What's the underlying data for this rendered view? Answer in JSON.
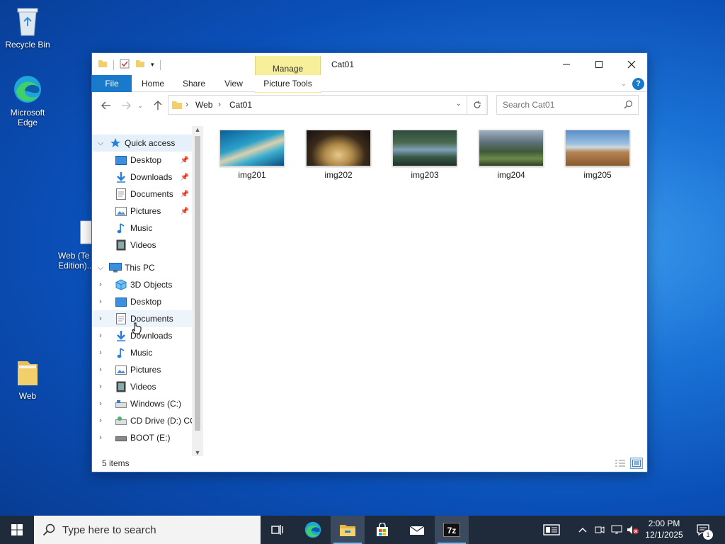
{
  "desktop": {
    "icons": [
      {
        "label": "Recycle Bin"
      },
      {
        "label": "Microsoft Edge"
      },
      {
        "label": "Web (Te Edition)..."
      },
      {
        "label": "Web"
      }
    ]
  },
  "window": {
    "title": "Cat01",
    "manage_tab": "Manage",
    "picture_tools_tab": "Picture Tools",
    "ribbon_tabs": [
      "File",
      "Home",
      "Share",
      "View"
    ],
    "help": "?",
    "address": {
      "crumbs": [
        "Web",
        "Cat01"
      ]
    },
    "search_placeholder": "Search Cat01"
  },
  "navpane": {
    "quick_access": "Quick access",
    "quick_items": [
      {
        "label": "Desktop",
        "icon": "desktop-icon"
      },
      {
        "label": "Downloads",
        "icon": "downloads-icon"
      },
      {
        "label": "Documents",
        "icon": "documents-icon"
      },
      {
        "label": "Pictures",
        "icon": "pictures-icon"
      },
      {
        "label": "Music",
        "icon": "music-icon"
      },
      {
        "label": "Videos",
        "icon": "videos-icon"
      }
    ],
    "this_pc": "This PC",
    "pc_items": [
      {
        "label": "3D Objects",
        "icon": "3d-objects-icon"
      },
      {
        "label": "Desktop",
        "icon": "desktop-icon"
      },
      {
        "label": "Documents",
        "icon": "documents-icon"
      },
      {
        "label": "Downloads",
        "icon": "downloads-icon"
      },
      {
        "label": "Music",
        "icon": "music-icon"
      },
      {
        "label": "Pictures",
        "icon": "pictures-icon"
      },
      {
        "label": "Videos",
        "icon": "videos-icon"
      },
      {
        "label": "Windows (C:)",
        "icon": "drive-icon"
      },
      {
        "label": "CD Drive (D:) CC",
        "icon": "cd-drive-icon"
      },
      {
        "label": "BOOT (E:)",
        "icon": "usb-drive-icon"
      }
    ]
  },
  "files": [
    {
      "name": "img201"
    },
    {
      "name": "img202"
    },
    {
      "name": "img203"
    },
    {
      "name": "img204"
    },
    {
      "name": "img205"
    }
  ],
  "status": {
    "count": "5 items"
  },
  "taskbar": {
    "search_placeholder": "Type here to search",
    "app_7z": "7z",
    "time": "2:00 PM",
    "date": "12/1/2025",
    "notification_count": "1"
  },
  "colors": {
    "accent": "#1979ca",
    "manage": "#f7ef9a",
    "taskbar": "#1f2a3a"
  }
}
